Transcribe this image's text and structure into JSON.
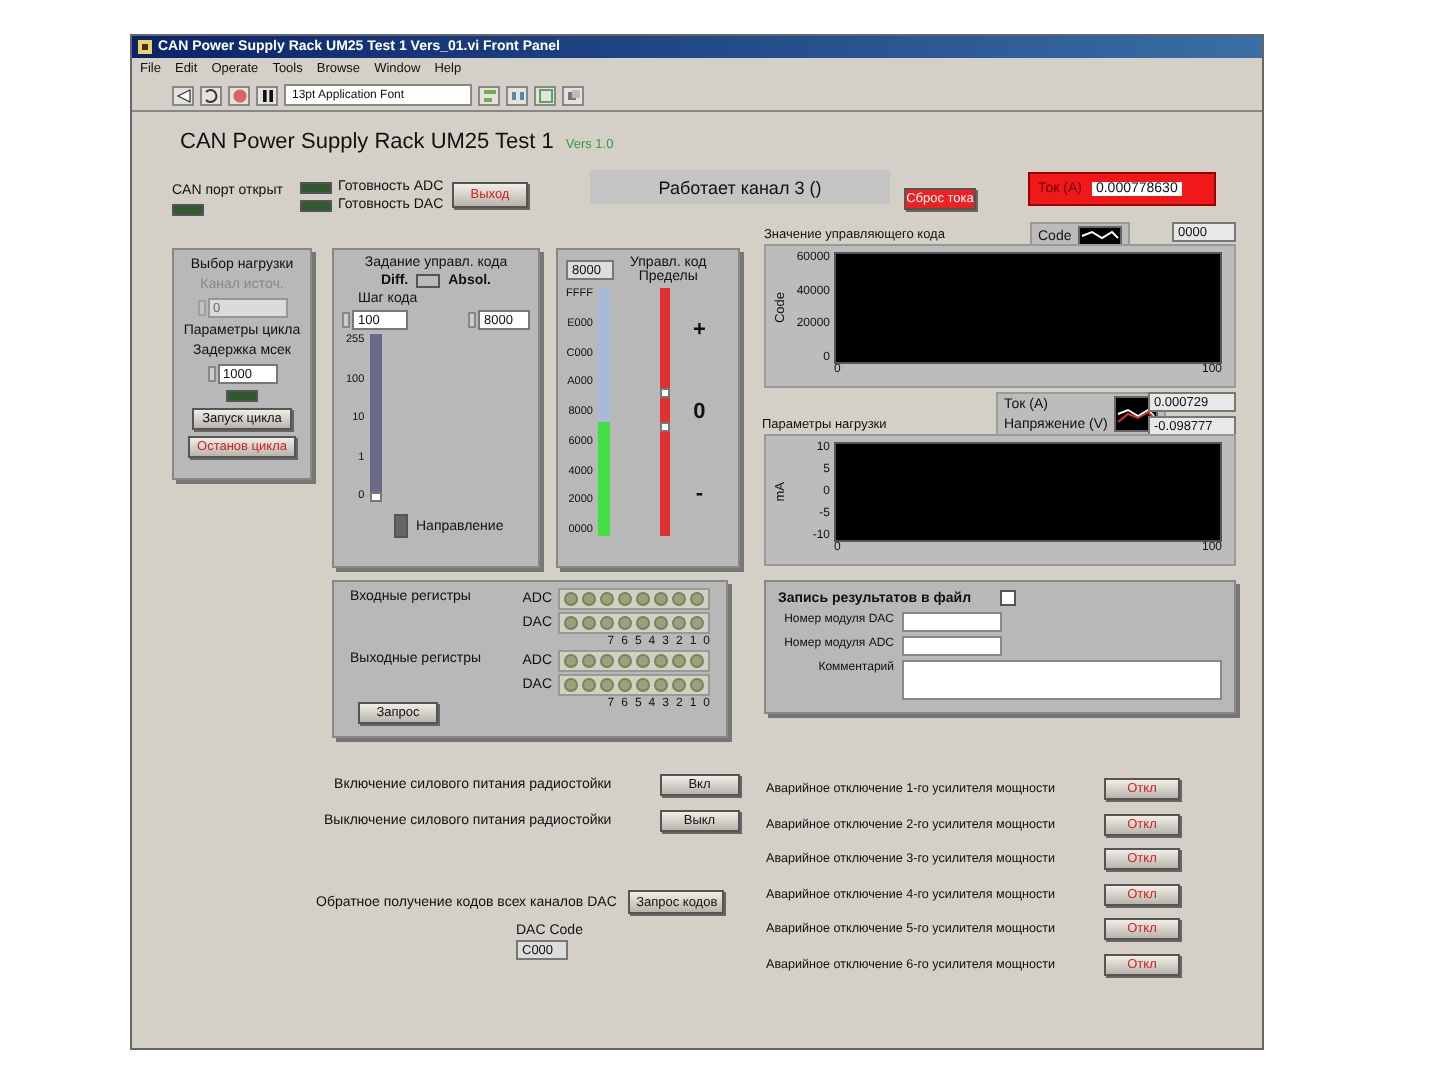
{
  "window": {
    "title": "CAN Power Supply Rack UM25 Test 1 Vers_01.vi Front Panel"
  },
  "menu": [
    "File",
    "Edit",
    "Operate",
    "Tools",
    "Browse",
    "Window",
    "Help"
  ],
  "toolbar": {
    "font": "13pt Application Font"
  },
  "heading": {
    "title": "CAN Power Supply Rack UM25 Test 1",
    "version": "Vers 1.0"
  },
  "can_port": {
    "label": "CAN порт открыт",
    "on": false
  },
  "ready_leds": [
    {
      "label": "Готовность ADC",
      "on": false
    },
    {
      "label": "Готовность DAC",
      "on": false
    }
  ],
  "exit_button": "Выход",
  "status": "Работает канал 3 ()",
  "reset_button": "Сброс тока",
  "current": {
    "label": "Ток (A)",
    "value": "0.000778630"
  },
  "load_panel": {
    "title": "Выбор нагрузки",
    "channel_label": "Канал источ.",
    "channel_value": "0",
    "disabled": true,
    "cycle_title": "Параметры цикла",
    "delay_label": "Задержка мсек",
    "delay_value": "1000",
    "led_on": false,
    "start_button": "Запуск цикла",
    "stop_button": "Останов цикла"
  },
  "code_panel": {
    "title": "Задание управл. кода",
    "diff_label": "Diff.",
    "absol_label": "Absol.",
    "mode_on": true,
    "step_label": "Шаг кода",
    "step_value": "100",
    "abs_value": "8000",
    "slider_ticks": [
      "255",
      "100",
      "10",
      "1",
      "0"
    ],
    "slider": {
      "level": 0
    },
    "direction": {
      "label": "Направление",
      "on": false
    }
  },
  "limit_panel": {
    "code_value": "8000",
    "title": "Управл. код",
    "limits_label": "Пределы",
    "scale": [
      "FFFF",
      "E000",
      "C000",
      "A000",
      "8000",
      "6000",
      "4000",
      "2000",
      "0000"
    ],
    "bar": {
      "level": 0.46
    },
    "limits": [
      {
        "level": 0.58
      },
      {
        "level": 0.44
      }
    ],
    "signs": [
      "+",
      "0",
      "-"
    ]
  },
  "code_chart": {
    "title": "Значение управляющего кода",
    "ylabel": "Code",
    "yticks": [
      "60000",
      "40000",
      "20000",
      "0"
    ],
    "xticks": [
      "0",
      "100"
    ],
    "legend": [
      {
        "name": "Code",
        "color": "#ffffff"
      }
    ],
    "readout": [
      "0000"
    ]
  },
  "load_chart": {
    "title": "Параметры нагрузки",
    "ylabel": "mA",
    "yticks": [
      "10",
      "5",
      "0",
      "-5",
      "-10"
    ],
    "xticks": [
      "0",
      "100"
    ],
    "legend": [
      {
        "name": "Ток (A)",
        "color": "#ffffff"
      },
      {
        "name": "Напряжение (V)",
        "color": "#e03030"
      }
    ],
    "readout": [
      "0.000729",
      "-0.098777"
    ]
  },
  "registers": {
    "groups": [
      {
        "title": "Входные регистры",
        "rows": [
          {
            "name": "ADC",
            "bits": [
              false,
              false,
              false,
              false,
              false,
              false,
              false,
              false
            ]
          },
          {
            "name": "DAC",
            "bits": [
              false,
              false,
              false,
              false,
              false,
              false,
              false,
              false
            ]
          }
        ],
        "bit_labels": [
          "7",
          "6",
          "5",
          "4",
          "3",
          "2",
          "1",
          "0"
        ]
      },
      {
        "title": "Выходные регистры",
        "rows": [
          {
            "name": "ADC",
            "bits": [
              false,
              false,
              false,
              false,
              false,
              false,
              false,
              false
            ]
          },
          {
            "name": "DAC",
            "bits": [
              false,
              false,
              false,
              false,
              false,
              false,
              false,
              false
            ]
          }
        ],
        "bit_labels": [
          "7",
          "6",
          "5",
          "4",
          "3",
          "2",
          "1",
          "0"
        ]
      }
    ],
    "request_button": "Запрос"
  },
  "file_panel": {
    "label": "Запись результатов в файл",
    "checked": false,
    "fields": [
      {
        "label": "Номер модуля DAC",
        "kind": "line"
      },
      {
        "label": "Номер модуля ADC",
        "kind": "line"
      },
      {
        "label": "Комментарий",
        "kind": "area"
      }
    ]
  },
  "power": [
    {
      "label": "Включение силового питания радиостойки",
      "button": "Вкл"
    },
    {
      "label": "Выключение силового питания радиостойки",
      "button": "Выкл"
    }
  ],
  "codes_request": {
    "label": "Обратное получение кодов всех каналов DAC",
    "button": "Запрос кодов",
    "code_label": "DAC Code",
    "code_value": "C000"
  },
  "alarms": [
    {
      "label": "Аварийное отключение 1-го усилителя мощности",
      "button": "Откл"
    },
    {
      "label": "Аварийное отключение 2-го усилителя мощности",
      "button": "Откл"
    },
    {
      "label": "Аварийное отключение 3-го усилителя мощности",
      "button": "Откл"
    },
    {
      "label": "Аварийное отключение 4-го усилителя мощности",
      "button": "Откл"
    },
    {
      "label": "Аварийное отключение 5-го усилителя мощности",
      "button": "Откл"
    },
    {
      "label": "Аварийное отключение 6-го усилителя мощности",
      "button": "Откл"
    }
  ]
}
